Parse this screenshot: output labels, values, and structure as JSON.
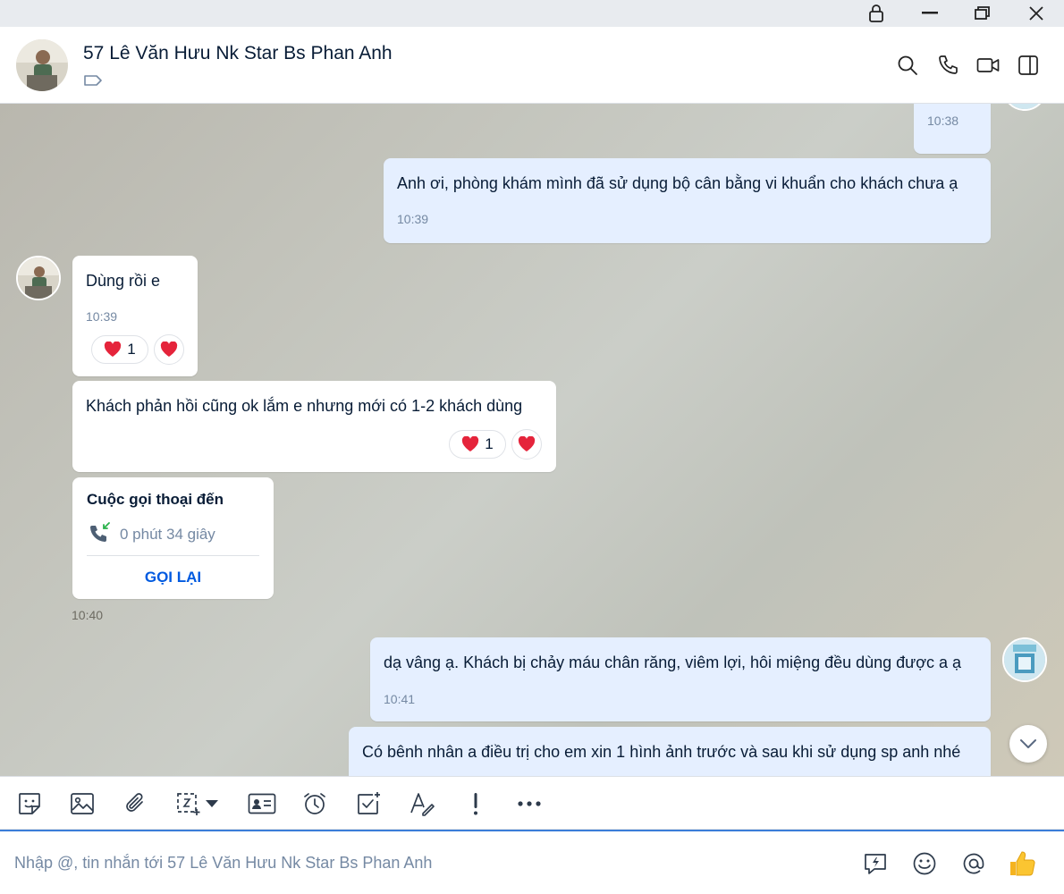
{
  "chat": {
    "title": "57 Lê Văn Hưu Nk Star Bs Phan Anh"
  },
  "messages": {
    "m0": {
      "time": "10:38"
    },
    "m1": {
      "text": "Anh ơi, phòng khám mình đã sử dụng bộ cân bằng vi khuẩn cho khách chưa ạ",
      "time": "10:39"
    },
    "m2": {
      "text": "Dùng rồi e",
      "time": "10:39",
      "reaction_count": "1"
    },
    "m3": {
      "text": "Khách phản hồi cũng ok lắm e nhưng mới có 1-2 khách dùng",
      "reaction_count": "1"
    },
    "call": {
      "title": "Cuộc gọi thoại đến",
      "duration": "0 phút 34 giây",
      "action": "GỌI LẠI",
      "time": "10:40"
    },
    "m4": {
      "text": "dạ vâng ạ. Khách bị chảy máu chân răng, viêm lợi, hôi miệng đều dùng được a ạ",
      "time": "10:41"
    },
    "m5": {
      "text": "Có bênh nhân a điều trị cho em xin 1 hình ảnh trước và sau khi sử dụng sp anh nhé"
    }
  },
  "composer": {
    "placeholder": "Nhập @, tin nhắn tới 57 Lê Văn Hưu Nk Star Bs Phan Anh"
  },
  "icons": {
    "titlebar": [
      "lock-icon",
      "minimize-icon",
      "restore-icon",
      "close-icon"
    ],
    "header": [
      "search-icon",
      "phone-icon",
      "video-icon",
      "sidebar-toggle-icon"
    ],
    "toolbar": [
      "sticker-icon",
      "image-icon",
      "attachment-icon",
      "screenshot-icon",
      "contact-card-icon",
      "reminder-icon",
      "task-icon",
      "text-format-icon",
      "urgent-icon",
      "more-icon"
    ],
    "composer": [
      "quick-message-icon",
      "emoji-icon",
      "mention-icon",
      "thumbs-up-icon"
    ]
  },
  "colors": {
    "accent": "#005ae0",
    "outgoing_bubble": "#e5efff",
    "incoming_bubble": "#ffffff",
    "heart": "#e5243b"
  }
}
